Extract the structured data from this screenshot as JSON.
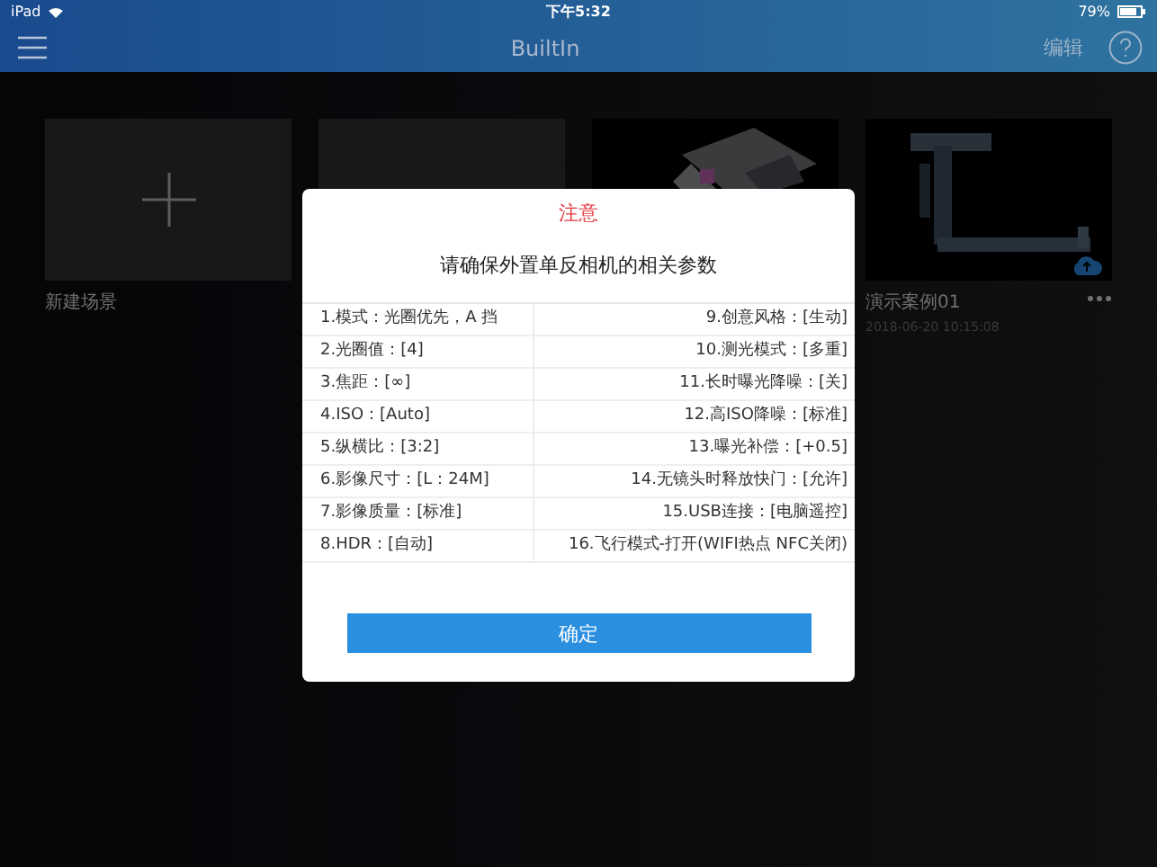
{
  "status_bar": {
    "device": "iPad",
    "time": "下午5:32",
    "battery": "79%"
  },
  "nav": {
    "title": "BuiltIn",
    "edit": "编辑"
  },
  "scenes": [
    {
      "kind": "new",
      "label": "新建场景"
    },
    {
      "kind": "blank"
    },
    {
      "kind": "picture"
    },
    {
      "kind": "picture",
      "label": "演示案例01",
      "date": "2018-06-20 10:15:08",
      "cloud": true
    }
  ],
  "dialog": {
    "title": "注意",
    "message": "请确保外置单反相机的相关参数",
    "rows": [
      [
        "1.模式：光圈优先，A 挡",
        "9.创意风格：[生动]"
      ],
      [
        "2.光圈值：[4]",
        "10.测光模式：[多重]"
      ],
      [
        "3.焦距：[∞]",
        "11.长时曝光降噪：[关]"
      ],
      [
        "4.ISO：[Auto]",
        "12.高ISO降噪：[标准]"
      ],
      [
        "5.纵横比：[3:2]",
        "13.曝光补偿：[+0.5]"
      ],
      [
        "6.影像尺寸：[L：24M]",
        "14.无镜头时释放快门：[允许]"
      ],
      [
        "7.影像质量：[标准]",
        "15.USB连接：[电脑遥控]"
      ],
      [
        "8.HDR：[自动]",
        "16.飞行模式-打开(WIFI热点 NFC关闭)"
      ]
    ],
    "button": "确定"
  }
}
